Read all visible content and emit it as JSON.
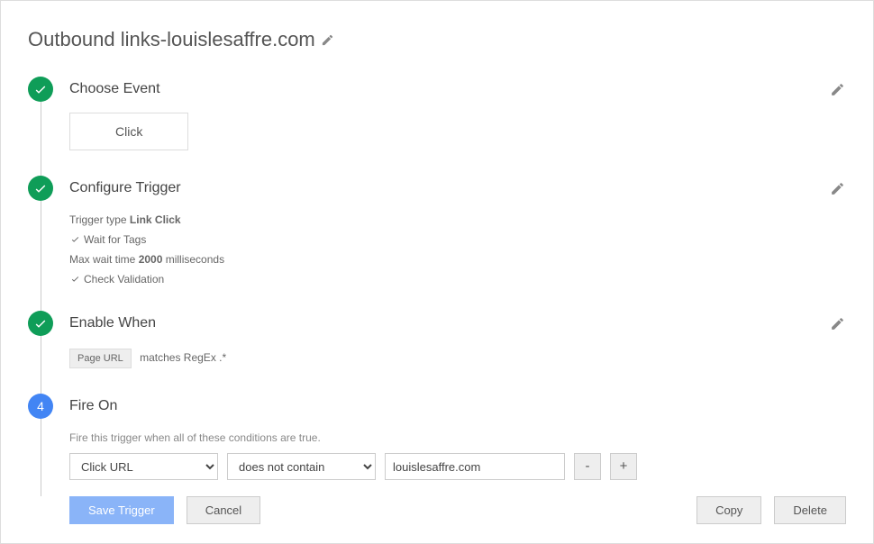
{
  "title": "Outbound links-louislesaffre.com",
  "steps": {
    "chooseEvent": {
      "title": "Choose Event",
      "value": "Click"
    },
    "configureTrigger": {
      "title": "Configure Trigger",
      "typeLabel": "Trigger type ",
      "typeValue": "Link Click",
      "waitForTags": "Wait for Tags",
      "maxWaitPrefix": "Max wait time ",
      "maxWaitValue": "2000",
      "maxWaitSuffix": " milliseconds",
      "checkValidation": "Check Validation"
    },
    "enableWhen": {
      "title": "Enable When",
      "variable": "Page URL",
      "condition": "matches RegEx .*"
    },
    "fireOn": {
      "number": "4",
      "title": "Fire On",
      "helper": "Fire this trigger when all of these conditions are true.",
      "variable": "Click URL",
      "operator": "does not contain",
      "value": "louislesaffre.com",
      "remove": "-",
      "add": "+"
    }
  },
  "buttons": {
    "save": "Save Trigger",
    "cancel": "Cancel",
    "copy": "Copy",
    "delete": "Delete"
  }
}
